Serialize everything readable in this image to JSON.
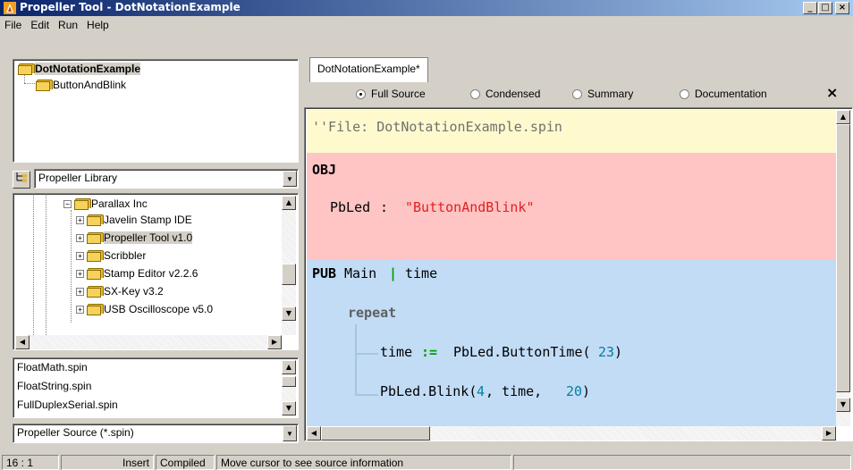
{
  "window": {
    "title": "Propeller Tool - DotNotationExample",
    "controls": [
      "_",
      "□",
      "×"
    ]
  },
  "menu": [
    "File",
    "Edit",
    "Run",
    "Help"
  ],
  "object_tree": [
    {
      "label": "DotNotationExample",
      "selected": true
    },
    {
      "label": "ButtonAndBlink",
      "selected": false
    }
  ],
  "library": {
    "combo": "Propeller Library",
    "folders": [
      {
        "label": "Parallax Inc",
        "expander": "−"
      },
      {
        "label": "Javelin Stamp IDE",
        "expander": "+"
      },
      {
        "label": "Propeller Tool v1.0",
        "expander": "+"
      },
      {
        "label": "Scribbler",
        "expander": "+"
      },
      {
        "label": "Stamp Editor v2.2.6",
        "expander": "+"
      },
      {
        "label": "SX-Key v3.2",
        "expander": "+"
      },
      {
        "label": "USB Oscilloscope v5.0",
        "expander": "+"
      }
    ],
    "files": [
      "FloatMath.spin",
      "FloatString.spin",
      "FullDuplexSerial.spin"
    ],
    "filter": "Propeller Source (*.spin)"
  },
  "editor": {
    "tab": "DotNotationExample*",
    "views": [
      {
        "label": "Full Source",
        "selected": true
      },
      {
        "label": "Condensed",
        "selected": false
      },
      {
        "label": "Summary",
        "selected": false
      },
      {
        "label": "Documentation",
        "selected": false
      }
    ],
    "close": "×",
    "code": {
      "comment": "''File: DotNotationExample.spin",
      "obj_kw": "OBJ",
      "obj_name": "PbLed",
      "obj_colon": ":",
      "obj_string": "\"ButtonAndBlink\"",
      "pub_kw": "PUB",
      "pub_name": "Main",
      "pub_bar": "|",
      "pub_local": "time",
      "repeat_kw": "repeat",
      "line1_a": "time",
      "line1_op": ":=",
      "line1_b": "PbLed.ButtonTime(",
      "line1_num": "23",
      "line1_c": ")",
      "line2_a": "PbLed.Blink(",
      "line2_n1": "4",
      "line2_b": ", time, ",
      "line2_n2": "20",
      "line2_c": ")"
    }
  },
  "colors": {
    "con_block": "#fffacd",
    "obj_block": "#ffc4c4",
    "pub_block": "#c2dcf6",
    "string": "#e02020",
    "number": "#0080a0",
    "operator": "#00a000"
  },
  "status": {
    "position": "16 : 1",
    "mode": "Insert",
    "state": "Compiled",
    "message": "Move cursor to see source information"
  }
}
